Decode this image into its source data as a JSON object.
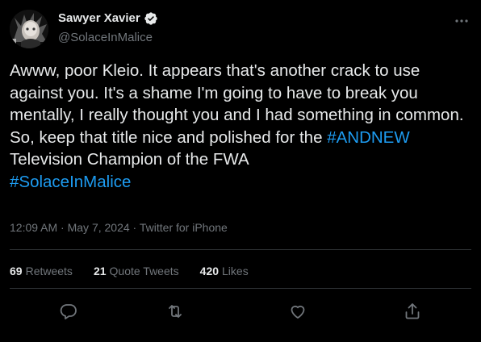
{
  "author": {
    "display_name": "Sawyer Xavier",
    "handle": "@SolaceInMalice",
    "verified": true
  },
  "tweet": {
    "text_part1": "Awww, poor Kleio. It appears that's another crack to use against you. It's a shame I'm going to have to break you mentally, I really thought you and I had something in common. So, keep that title nice and polished for the ",
    "hashtag1": "#ANDNEW",
    "text_part2": " Television Champion of the FWA\n",
    "hashtag2": "#SolaceInMalice"
  },
  "meta": {
    "time": "12:09 AM",
    "sep1": " · ",
    "date": "May 7, 2024",
    "sep2": " · ",
    "source": "Twitter for iPhone"
  },
  "stats": {
    "retweets_count": "69",
    "retweets_label": "Retweets",
    "quotes_count": "21",
    "quotes_label": "Quote Tweets",
    "likes_count": "420",
    "likes_label": "Likes"
  },
  "icons": {
    "verified": "verified-badge-icon",
    "more": "more-icon",
    "reply": "reply-icon",
    "retweet": "retweet-icon",
    "like": "like-icon",
    "share": "share-icon"
  },
  "colors": {
    "background": "#000000",
    "text": "#e7e9ea",
    "secondary": "#71767b",
    "accent": "#1d9bf0",
    "divider": "#2f3336"
  }
}
